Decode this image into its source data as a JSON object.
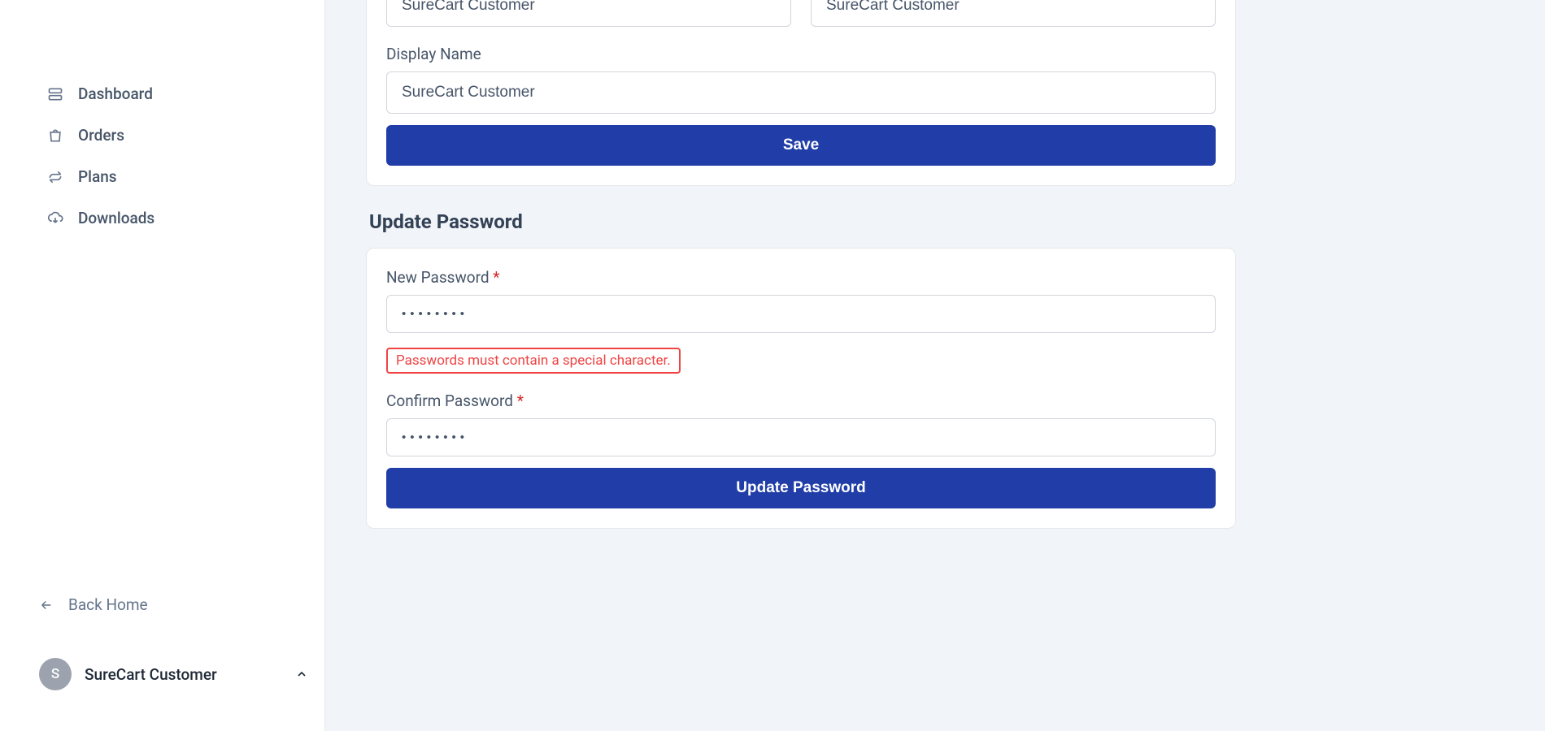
{
  "sidebar": {
    "items": [
      {
        "label": "Dashboard",
        "icon": "dashboard"
      },
      {
        "label": "Orders",
        "icon": "bag"
      },
      {
        "label": "Plans",
        "icon": "refresh"
      },
      {
        "label": "Downloads",
        "icon": "download-cloud"
      }
    ],
    "back_label": "Back Home",
    "user": {
      "initial": "S",
      "name": "SureCart Customer"
    }
  },
  "profile": {
    "first_name_value": "SureCart Customer",
    "last_name_value": "SureCart Customer",
    "display_name_label": "Display Name",
    "display_name_value": "SureCart Customer",
    "save_label": "Save"
  },
  "password_section": {
    "heading": "Update Password",
    "new_label": "New Password",
    "new_value": "••••••••",
    "error": "Passwords must contain a special character.",
    "confirm_label": "Confirm Password",
    "confirm_value": "••••••••",
    "submit_label": "Update Password",
    "required_mark": "*"
  }
}
